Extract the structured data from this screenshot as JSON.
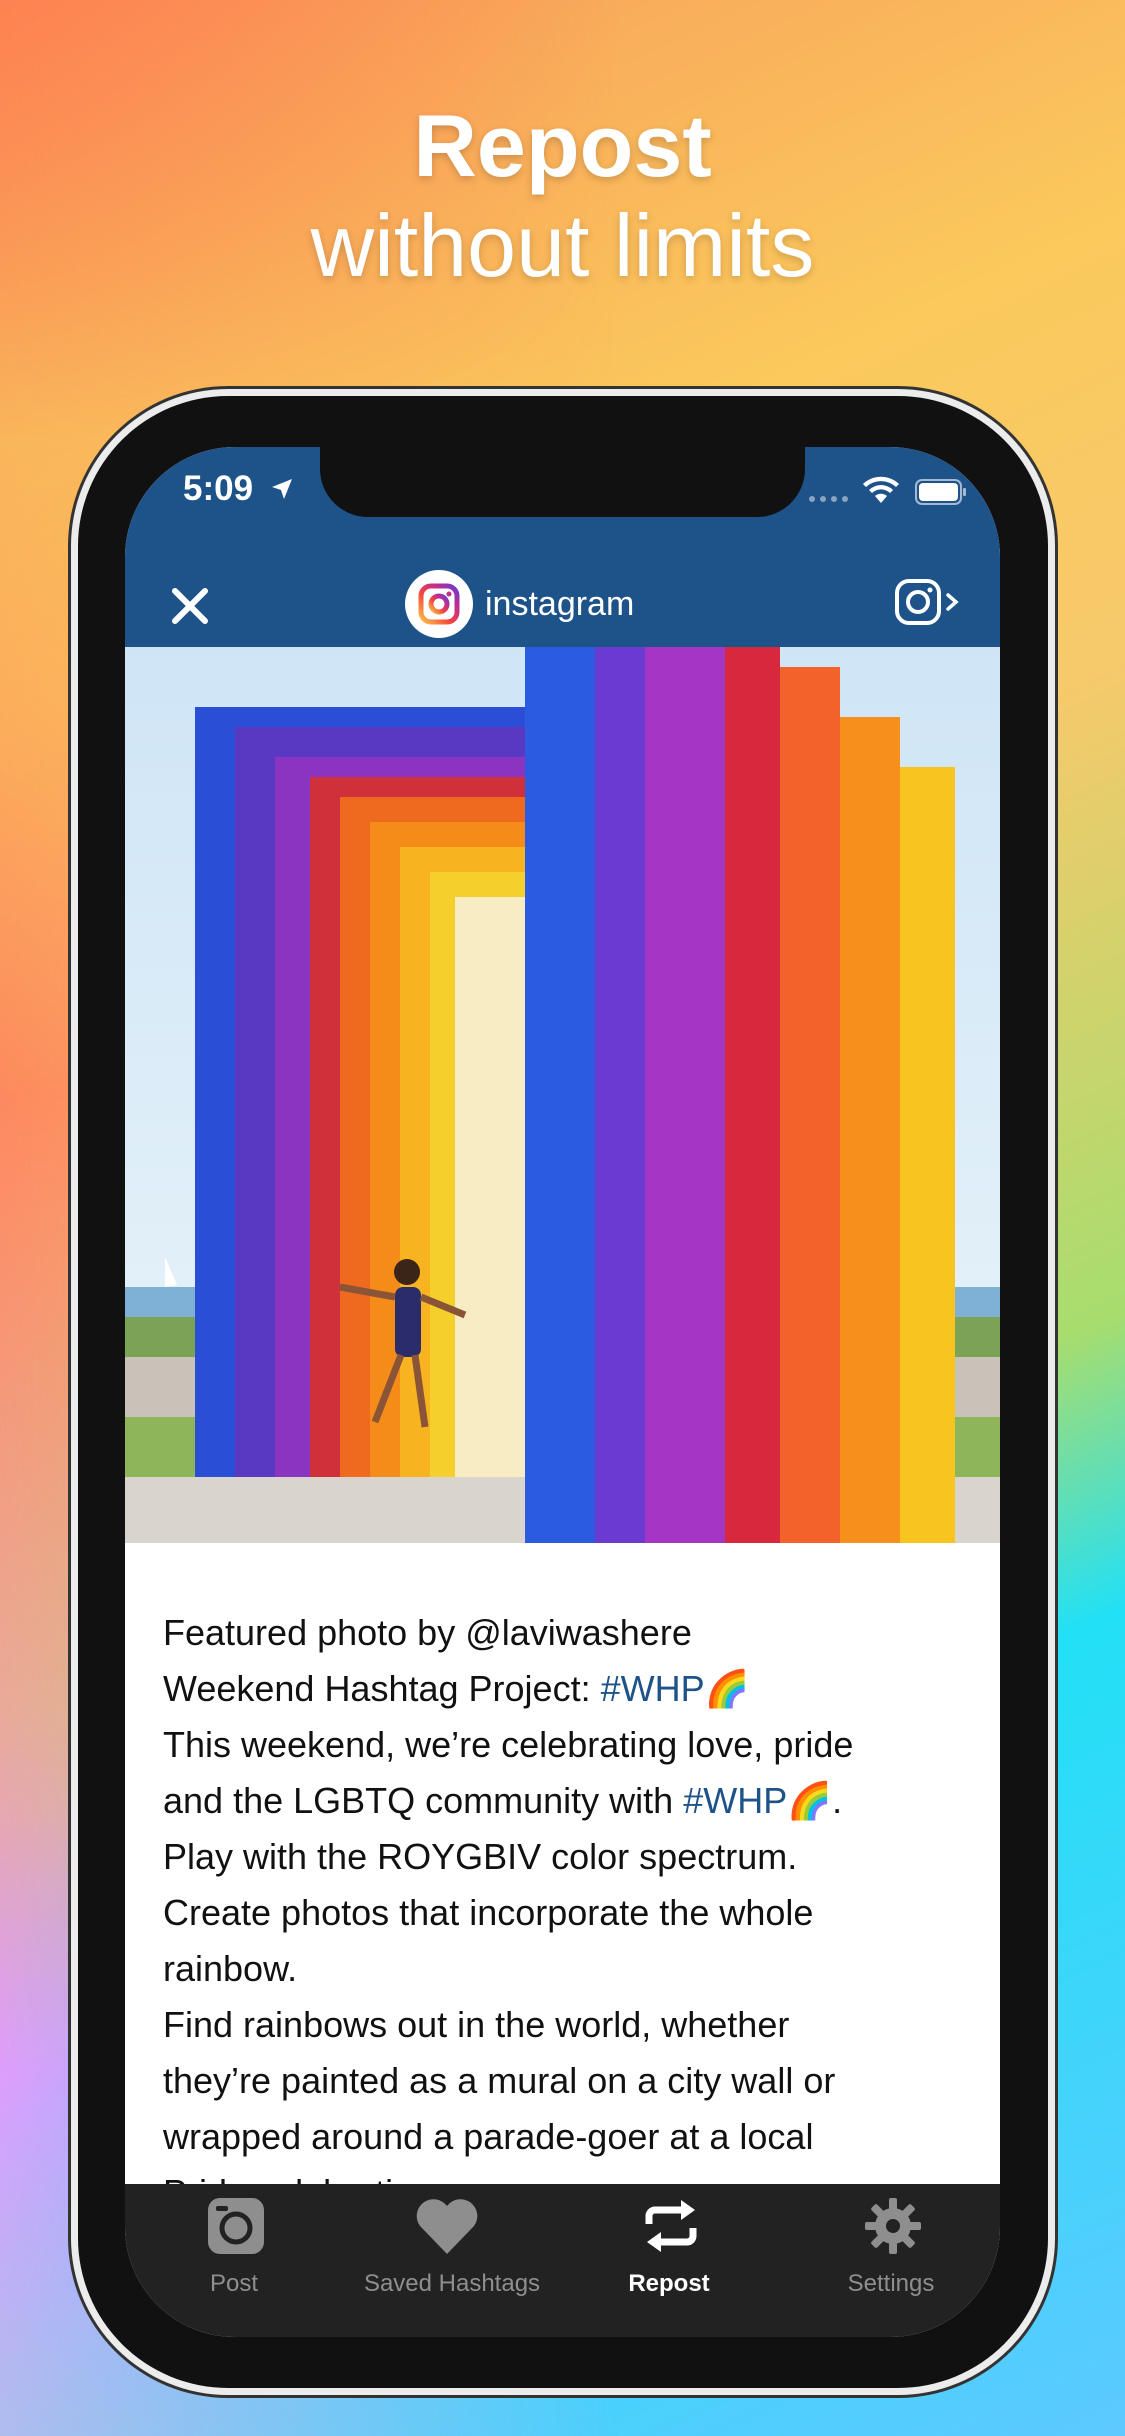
{
  "headline": {
    "line1": "Repost",
    "line2": "without limits"
  },
  "status_bar": {
    "time": "5:09",
    "icons": [
      "location-arrow-icon",
      "signal-dots-icon",
      "wifi-icon",
      "battery-icon"
    ]
  },
  "navbar": {
    "account_name": "instagram",
    "close_icon": "close-icon",
    "open_icon": "open-in-instagram-icon"
  },
  "caption": {
    "line1": "Featured photo by @laviwashere",
    "line2_text": "Weekend Hashtag Project: ",
    "line2_tag": "#WHP",
    "line3": "This weekend, we’re celebrating love, pride",
    "line4_text": "and the LGBTQ community with ",
    "line4_tag": "#WHP",
    "line4_end": ".",
    "line5": "Play with the ROYGBIV color spectrum.",
    "line6": "Create photos that incorporate the whole",
    "line7": "rainbow.",
    "line8": "Find rainbows out in the world, whether",
    "line9": "they’re painted as a mural on a city wall or",
    "line10": "wrapped around a parade-goer at a local",
    "line11": "Pride celebration."
  },
  "tabbar": {
    "tabs": [
      {
        "label": "Post",
        "icon": "camera-icon",
        "active": false
      },
      {
        "label": "Saved Hashtags",
        "icon": "heart-icon",
        "active": false
      },
      {
        "label": "Repost",
        "icon": "repost-icon",
        "active": true
      },
      {
        "label": "Settings",
        "icon": "gear-icon",
        "active": false
      }
    ]
  },
  "colors": {
    "navbar": "#1d5389",
    "tabbar": "#222222",
    "hashtag": "#1d5389"
  }
}
